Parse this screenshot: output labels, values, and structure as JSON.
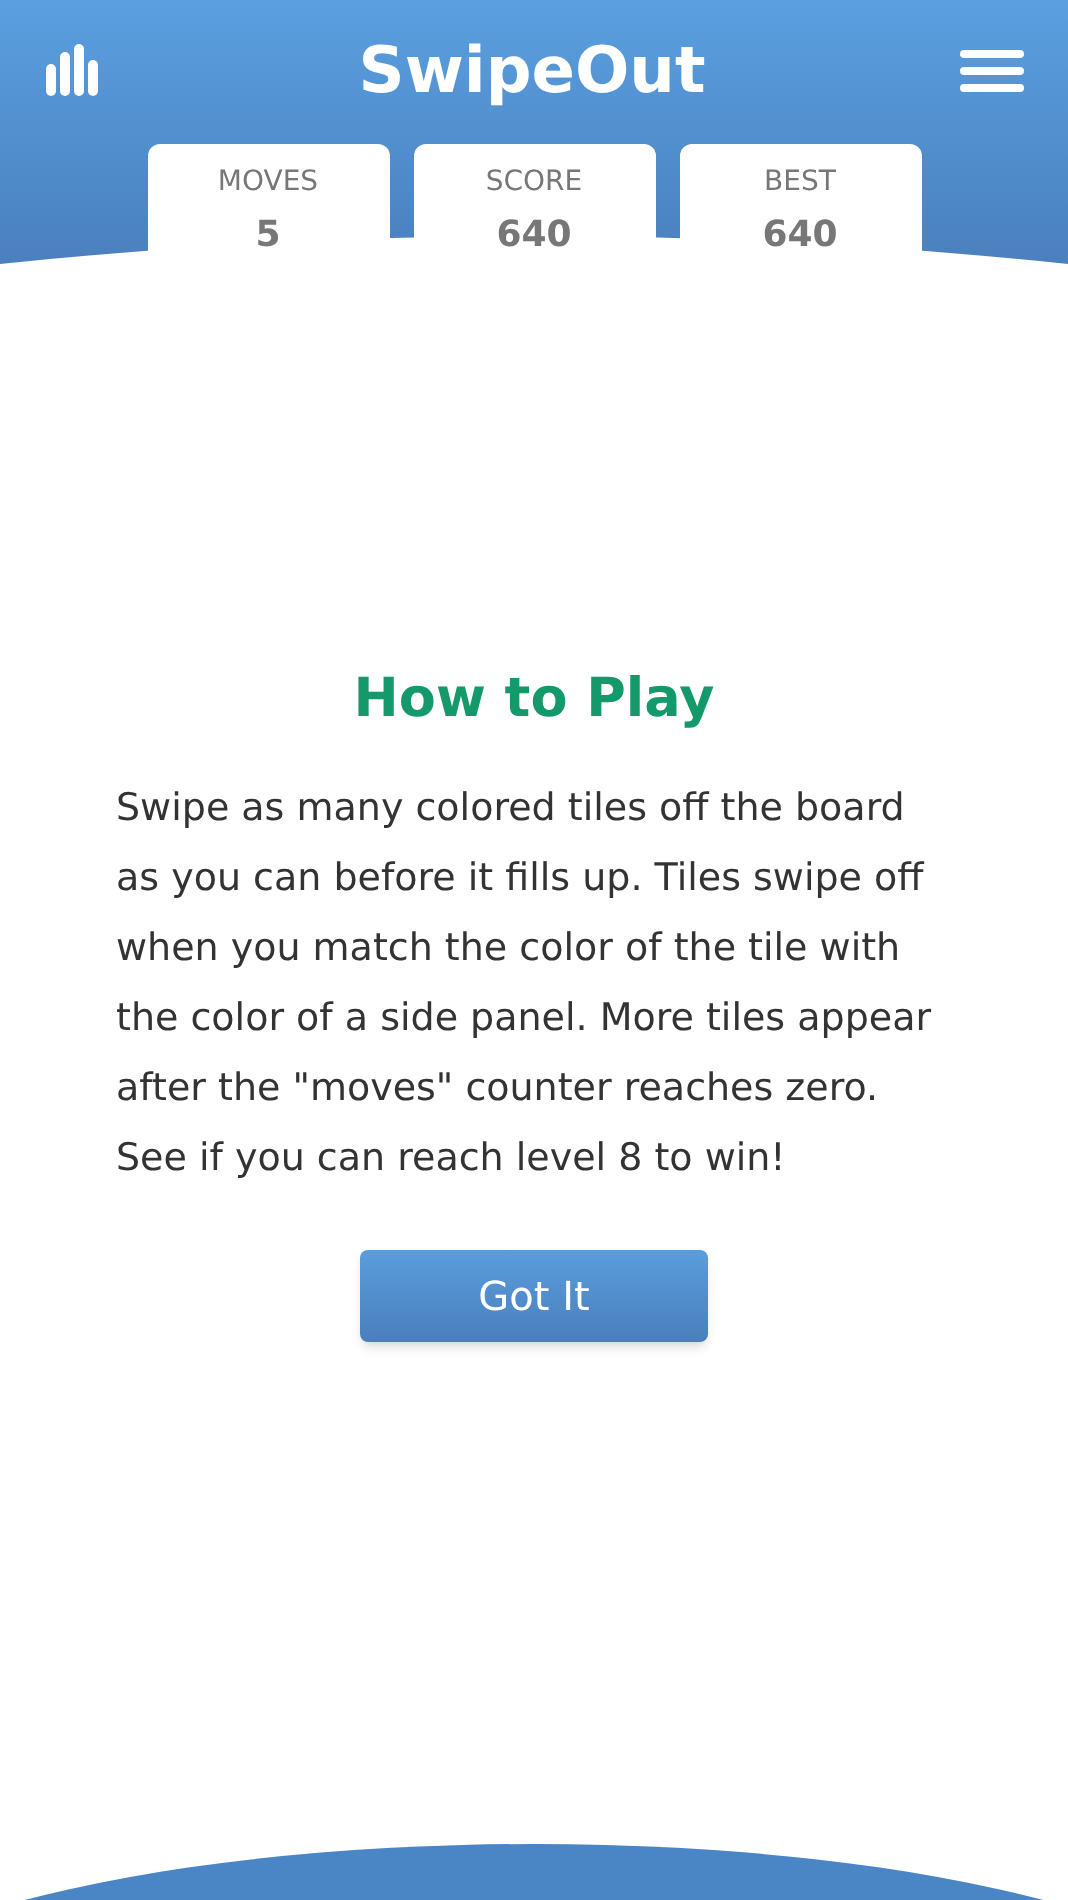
{
  "header": {
    "title": "SwipeOut"
  },
  "stats": [
    {
      "label": "MOVES",
      "value": "5"
    },
    {
      "label": "SCORE",
      "value": "640"
    },
    {
      "label": "BEST",
      "value": "640"
    }
  ],
  "dialog": {
    "title": "How to Play",
    "lines": [
      "Swipe as many colored tiles off the board",
      "as you can before it fills up. Tiles swipe off",
      "when you match the color of the tile with",
      "the color of a side panel. More tiles appear",
      "after the \"moves\" counter reaches zero.",
      "See if you can reach level 8 to win!"
    ],
    "button": "Got It"
  }
}
